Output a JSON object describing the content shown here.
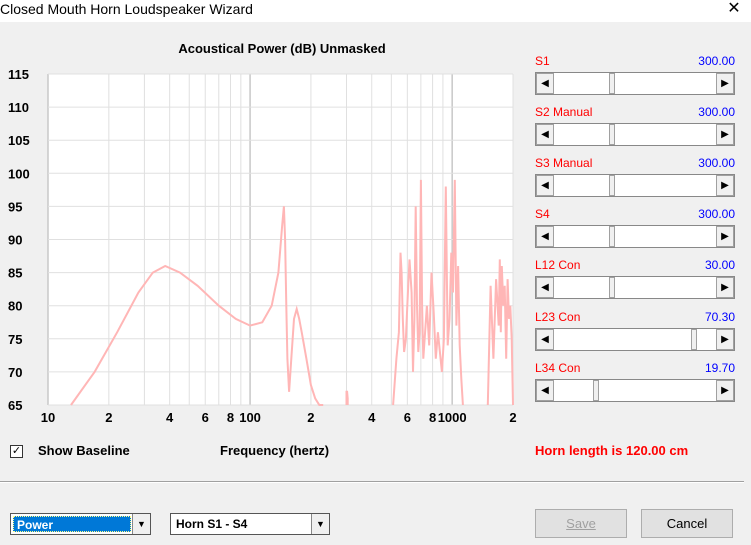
{
  "window": {
    "title": "Closed Mouth Horn Loudspeaker Wizard",
    "close_glyph": "✕"
  },
  "chart_data": {
    "type": "line",
    "title": "Acoustical Power (dB)   Unmasked",
    "xlabel": "Frequency (hertz)",
    "ylabel": "",
    "x_scale": "log",
    "xlim": [
      10,
      2000
    ],
    "ylim": [
      65,
      115
    ],
    "y_ticks": [
      65,
      70,
      75,
      80,
      85,
      90,
      95,
      100,
      105,
      110,
      115
    ],
    "x_tick_labels": [
      {
        "value": 10,
        "label": "10"
      },
      {
        "value": 20,
        "label": "2"
      },
      {
        "value": 40,
        "label": "4"
      },
      {
        "value": 60,
        "label": "6"
      },
      {
        "value": 80,
        "label": "8"
      },
      {
        "value": 100,
        "label": "100"
      },
      {
        "value": 200,
        "label": "2"
      },
      {
        "value": 400,
        "label": "4"
      },
      {
        "value": 600,
        "label": "6"
      },
      {
        "value": 800,
        "label": "8"
      },
      {
        "value": 1000,
        "label": "1000"
      },
      {
        "value": 2000,
        "label": "2"
      }
    ],
    "line_color": "#ffb6b6",
    "grid": true,
    "series": [
      {
        "x": [
          13,
          17,
          22,
          28,
          33,
          38,
          45,
          55,
          70,
          85,
          100,
          115,
          128,
          138,
          144,
          147,
          149,
          151,
          153,
          156,
          160,
          165,
          170,
          175,
          180,
          190,
          200,
          210,
          220,
          230
        ],
        "y": [
          65,
          70,
          76,
          82,
          85,
          86,
          85,
          83,
          80,
          78,
          77,
          77.5,
          80,
          85,
          92,
          95,
          90,
          80,
          72,
          67,
          72,
          78,
          79.5,
          78,
          76,
          72,
          68,
          66,
          65,
          65
        ]
      },
      {
        "x": [
          300,
          300,
          302,
          304,
          304
        ],
        "y": [
          65,
          67,
          67,
          66,
          65
        ]
      },
      {
        "x": [
          510,
          530,
          545,
          555,
          562,
          570,
          578,
          590,
          600,
          615,
          630,
          640,
          650,
          660,
          670,
          680,
          690,
          700,
          710,
          720,
          735,
          750,
          770,
          790,
          810,
          830,
          850,
          870,
          890,
          910,
          930,
          950,
          970,
          990,
          1010,
          1030,
          1050,
          1070,
          1090,
          1110,
          1130
        ],
        "y": [
          65,
          72,
          76,
          88,
          85,
          78,
          73,
          75,
          80,
          87,
          82,
          70,
          78,
          95,
          80,
          73,
          76,
          99,
          80,
          72,
          76,
          80,
          74,
          85,
          79,
          72,
          76,
          73,
          70,
          75,
          98,
          74,
          78,
          88,
          82,
          99,
          77,
          86,
          74,
          69,
          65
        ]
      },
      {
        "x": [
          1500,
          1550,
          1600,
          1650,
          1700,
          1720,
          1740,
          1760,
          1790,
          1820,
          1850,
          1880,
          1910,
          1940,
          1970,
          2000
        ],
        "y": [
          65,
          83,
          72,
          84,
          77,
          87,
          76,
          86,
          80,
          83,
          72,
          84,
          78,
          80,
          75,
          65
        ]
      }
    ]
  },
  "controls": {
    "params": [
      {
        "label": "S1",
        "value": "300.00",
        "position": 0.35
      },
      {
        "label": "S2 Manual",
        "value": "300.00",
        "position": 0.35
      },
      {
        "label": "S3 Manual",
        "value": "300.00",
        "position": 0.35
      },
      {
        "label": "S4",
        "value": "300.00",
        "position": 0.35
      },
      {
        "label": "L12 Con",
        "value": "30.00",
        "position": 0.35
      },
      {
        "label": "L23 Con",
        "value": "70.30",
        "position": 0.88
      },
      {
        "label": "L34 Con",
        "value": "19.70",
        "position": 0.25
      }
    ],
    "left_arrow": "◀",
    "right_arrow": "▶"
  },
  "footer": {
    "horn_length": "Horn length is 120.00 cm",
    "show_baseline_label": "Show Baseline",
    "show_baseline_checked": "✓",
    "frequency_label": "Frequency (hertz)",
    "dropdown_metric": "Power",
    "dropdown_horn": "Horn S1 - S4",
    "dropdown_arrow": "▼",
    "save_label": "Save",
    "cancel_label": "Cancel"
  }
}
